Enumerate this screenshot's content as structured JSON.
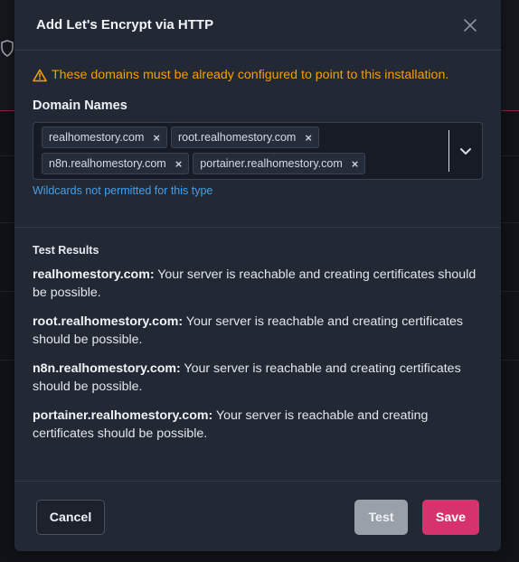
{
  "modal": {
    "title": "Add Let's Encrypt via HTTP",
    "warning": "These domains must be already configured to point to this installation.",
    "domain_names_label": "Domain Names",
    "domains": [
      "realhomestory.com",
      "root.realhomestory.com",
      "n8n.realhomestory.com",
      "portainer.realhomestory.com"
    ],
    "tag_remove_symbol": "×",
    "help_text": "Wildcards not permitted for this type",
    "test_results_title": "Test Results",
    "results": [
      {
        "domain": "realhomestory.com:",
        "message": " Your server is reachable and creating certificates should be possible."
      },
      {
        "domain": "root.realhomestory.com:",
        "message": " Your server is reachable and creating certificates should be possible."
      },
      {
        "domain": "n8n.realhomestory.com:",
        "message": " Your server is reachable and creating certificates should be possible."
      },
      {
        "domain": "portainer.realhomestory.com:",
        "message": " Your server is reachable and creating certificates should be possible."
      }
    ],
    "buttons": {
      "cancel": "Cancel",
      "test": "Test",
      "save": "Save"
    }
  },
  "icons": {
    "close": "close-icon",
    "warning": "warning-triangle-icon",
    "dropdown": "chevron-down-icon",
    "background_shield": "shield-icon"
  },
  "colors": {
    "warning": "#f59f00",
    "help_text": "#4a9fe5",
    "save_button": "#d6336c",
    "test_button": "#9aa0a9",
    "modal_background": "#222834"
  }
}
